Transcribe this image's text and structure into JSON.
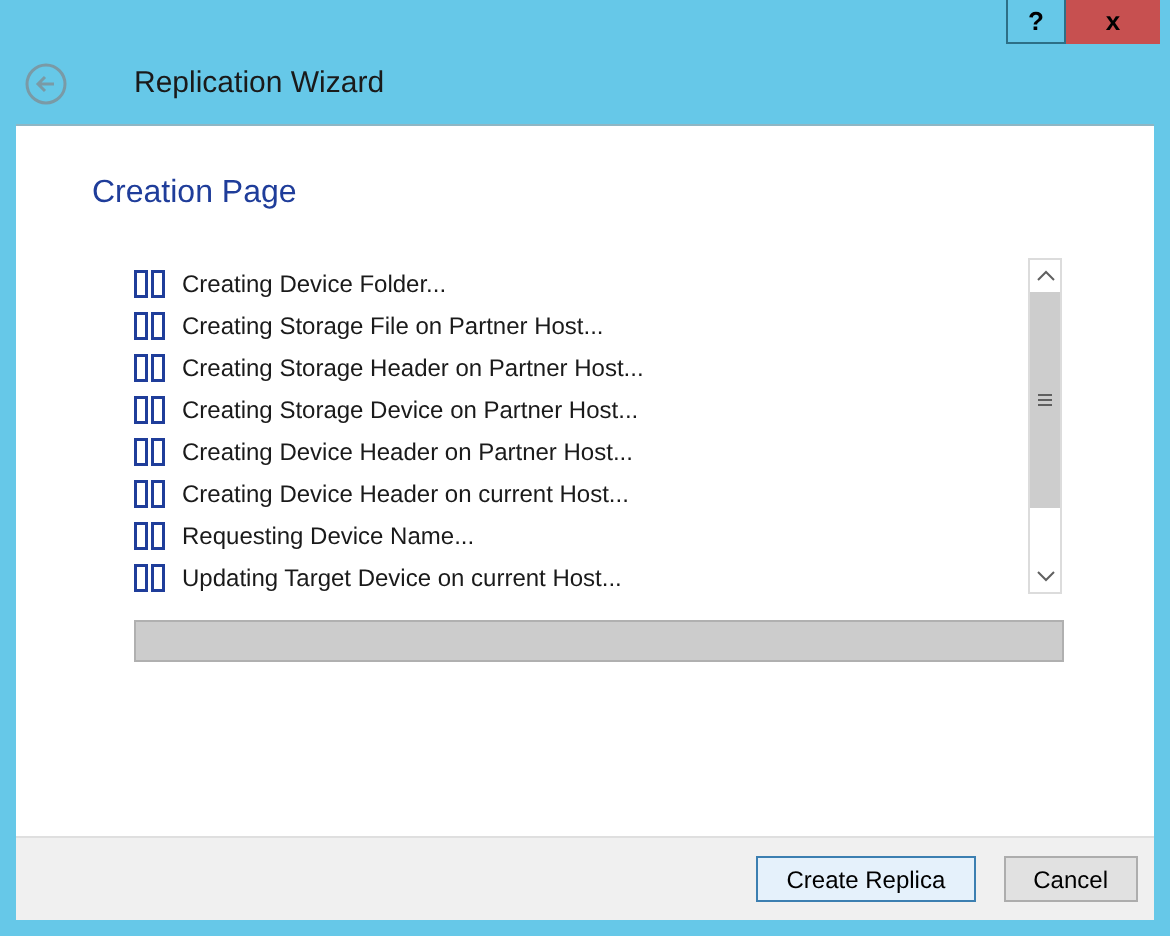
{
  "window": {
    "title": "Replication Wizard",
    "help_button": "?",
    "close_button": "x"
  },
  "page_title": "Creation Page",
  "steps": [
    {
      "label": "Creating Device Folder..."
    },
    {
      "label": "Creating Storage File on Partner Host..."
    },
    {
      "label": "Creating Storage Header on Partner Host..."
    },
    {
      "label": "Creating Storage Device on Partner Host..."
    },
    {
      "label": "Creating Device Header on Partner Host..."
    },
    {
      "label": "Creating Device Header on current Host..."
    },
    {
      "label": "Requesting Device Name..."
    },
    {
      "label": "Updating Target Device on current Host..."
    }
  ],
  "buttons": [
    {
      "label": "Create Replica",
      "selected": true
    },
    {
      "label": "Cancel",
      "selected": false
    }
  ]
}
